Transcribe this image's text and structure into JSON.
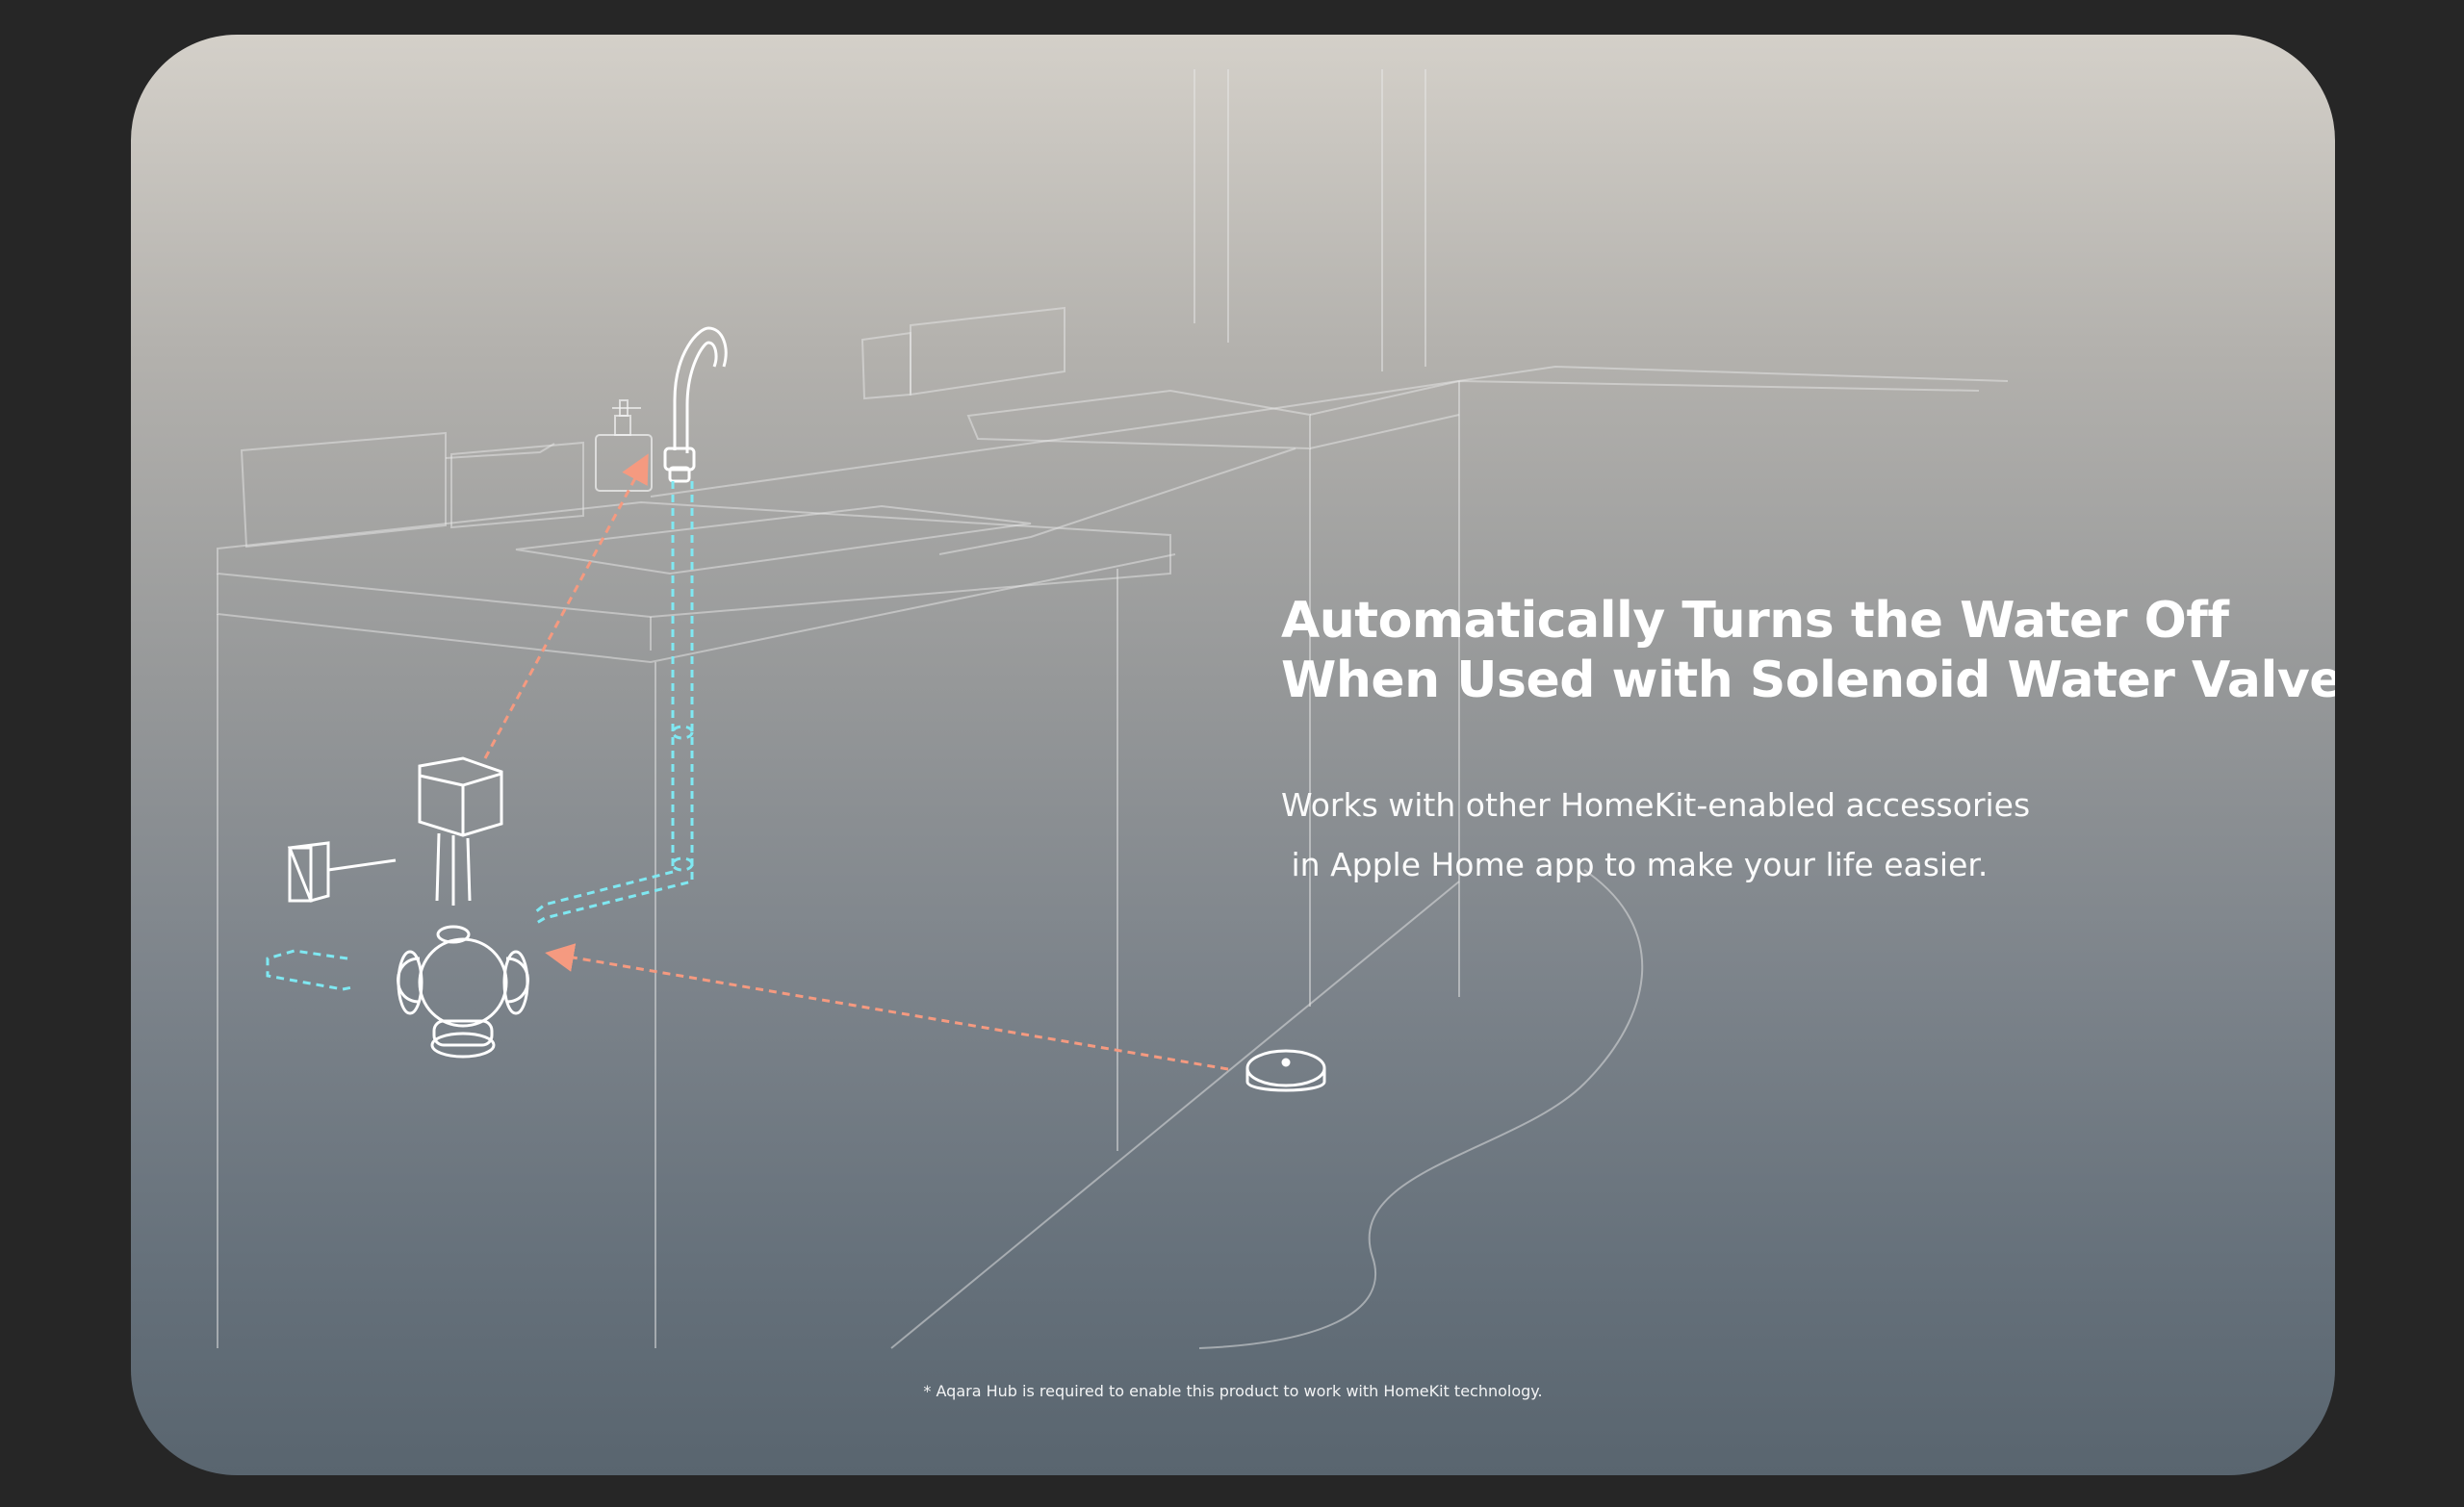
{
  "headline": {
    "line1": "Automatically Turns the Water Off",
    "line2": "When Used with Solenoid Water Valve"
  },
  "subtext": {
    "line1": "Works with other HomeKit-enabled accessories",
    "line2": " in Apple Home app to make your life easier."
  },
  "footnote": "* Aqara Hub is required to enable this product to work with HomeKit technology.",
  "colors": {
    "page_background": "#262626",
    "card_top": "#d4d0c9",
    "card_bottom": "#59656f",
    "sensor_signal_arrow": "#f59a80",
    "water_pipe": "#7fe8f2",
    "line_art": "#e6e6e6"
  },
  "illustration": {
    "elements": [
      "kitchen-counter",
      "faucet",
      "solenoid-water-valve",
      "water-leak-sensor",
      "water-pipe",
      "signal-arrow"
    ]
  }
}
